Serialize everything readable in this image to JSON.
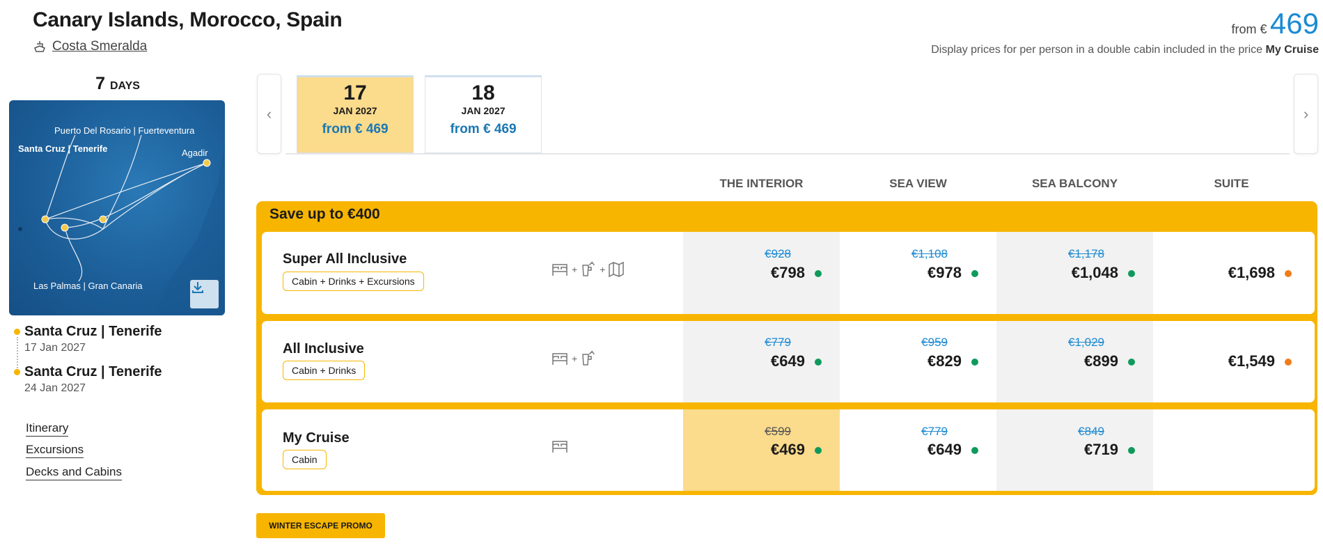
{
  "header": {
    "title": "Canary Islands, Morocco, Spain",
    "ship_name": "Costa Smeralda",
    "from_label": "from €",
    "from_price": "469",
    "note_prefix": "Display prices for per person in a double cabin included in the price",
    "note_bold": "My Cruise"
  },
  "duration": {
    "number": "7",
    "label": "DAYS"
  },
  "map": {
    "labels": {
      "puerto": "Puerto Del Rosario | Fuerteventura",
      "santa_cruz": "Santa Cruz | Tenerife",
      "agadir": "Agadir",
      "las_palmas": "Las Palmas | Gran Canaria"
    }
  },
  "itinerary": [
    {
      "port": "Santa Cruz | Tenerife",
      "date": "17 Jan 2027"
    },
    {
      "port": "Santa Cruz | Tenerife",
      "date": "24 Jan 2027"
    }
  ],
  "side_links": [
    "Itinerary",
    "Excursions",
    "Decks and Cabins"
  ],
  "dates": [
    {
      "day": "17",
      "month_year": "JAN 2027",
      "from": "from € 469",
      "selected": true
    },
    {
      "day": "18",
      "month_year": "JAN 2027",
      "from": "from € 469",
      "selected": false
    }
  ],
  "columns": [
    "THE INTERIOR",
    "SEA VIEW",
    "SEA BALCONY",
    "SUITE"
  ],
  "save_banner": "Save up to €400",
  "packages": [
    {
      "name": "Super All Inclusive",
      "badge": "Cabin + Drinks + Excursions",
      "icons": [
        "bed-icon",
        "drink-icon",
        "map-icon"
      ],
      "prices": [
        {
          "old": "€928",
          "new": "€798",
          "status": "green"
        },
        {
          "old": "€1,108",
          "new": "€978",
          "status": "green"
        },
        {
          "old": "€1,178",
          "new": "€1,048",
          "status": "green"
        },
        {
          "old": "",
          "new": "€1,698",
          "status": "orange"
        }
      ]
    },
    {
      "name": "All Inclusive",
      "badge": "Cabin + Drinks",
      "icons": [
        "bed-icon",
        "drink-icon"
      ],
      "prices": [
        {
          "old": "€779",
          "new": "€649",
          "status": "green"
        },
        {
          "old": "€959",
          "new": "€829",
          "status": "green"
        },
        {
          "old": "€1,029",
          "new": "€899",
          "status": "green"
        },
        {
          "old": "",
          "new": "€1,549",
          "status": "orange"
        }
      ]
    },
    {
      "name": "My Cruise",
      "badge": "Cabin",
      "icons": [
        "bed-icon"
      ],
      "prices": [
        {
          "old": "€599",
          "new": "€469",
          "status": "green"
        },
        {
          "old": "€779",
          "new": "€649",
          "status": "green"
        },
        {
          "old": "€849",
          "new": "€719",
          "status": "green"
        }
      ]
    }
  ],
  "promo_button": "WINTER ESCAPE PROMO",
  "colors": {
    "accent": "#f7b500",
    "link_blue": "#1a8ad3",
    "available": "#0f9a5c",
    "limited": "#f07c1a",
    "selected_bg": "#fbdb8c"
  }
}
